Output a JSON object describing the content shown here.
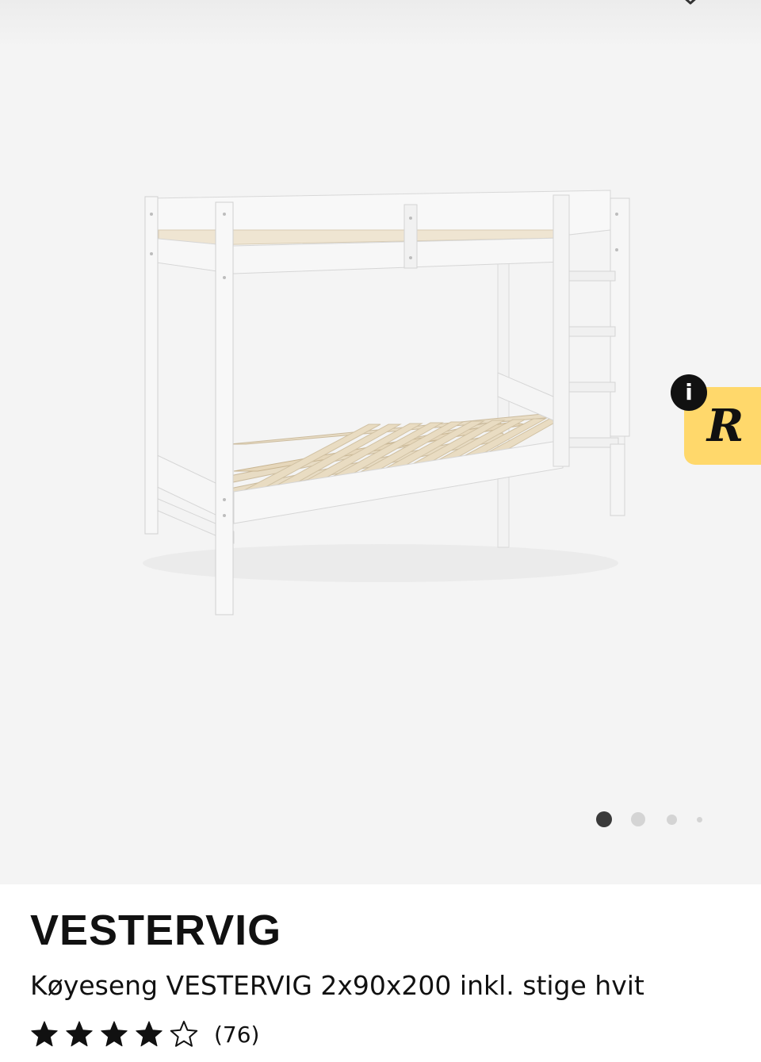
{
  "product": {
    "brand": "VESTERVIG",
    "title": "Køyeseng VESTERVIG 2x90x200 inkl. stige hvit",
    "rating": 4,
    "rating_max": 5,
    "review_count": "(76)"
  },
  "gallery": {
    "image_count": 4,
    "active_index": 0
  },
  "widget": {
    "info_label": "i",
    "logo_letter": "R",
    "accent_color": "#ffd86b"
  },
  "icons": {
    "top": "chevron-down-icon",
    "info": "info-icon",
    "star": "star-icon"
  }
}
